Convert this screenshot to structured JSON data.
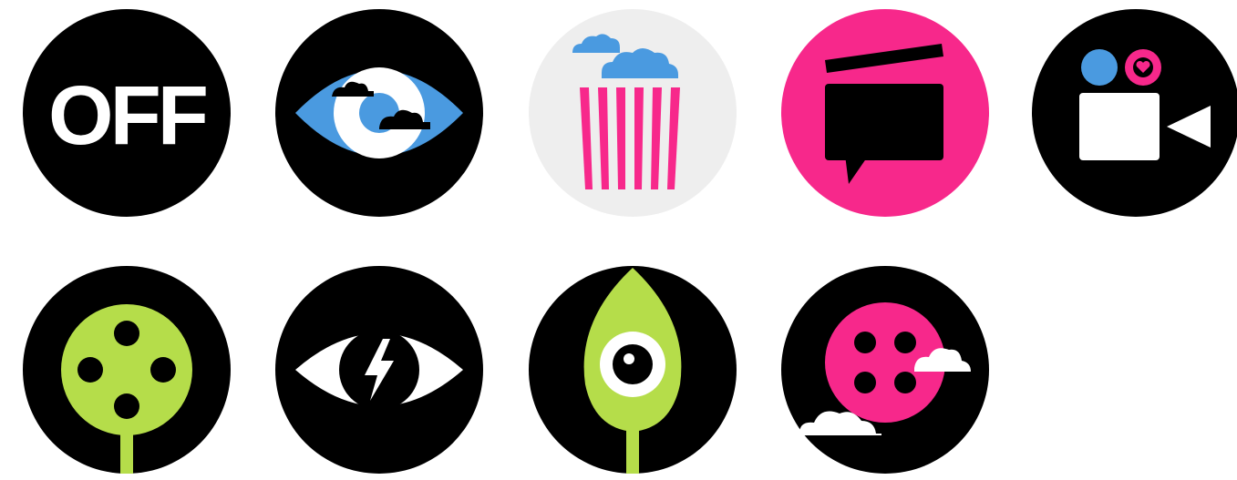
{
  "icons": [
    {
      "name": "off-badge",
      "label": "OFF",
      "text_color": "#ffffff",
      "background": "#000000"
    },
    {
      "name": "eye-clouds-badge",
      "background": "#000000",
      "accent": "#4a9ae0"
    },
    {
      "name": "popcorn-badge",
      "background": "#eeeeee",
      "accent": "#f7288b",
      "secondary": "#4a9ae0"
    },
    {
      "name": "clapperboard-speech-badge",
      "background": "#f7288b",
      "accent": "#000000"
    },
    {
      "name": "video-camera-heart-badge",
      "background": "#000000",
      "accent": "#4a9ae0",
      "secondary": "#f7288b"
    },
    {
      "name": "film-reel-tree-badge",
      "background": "#000000",
      "accent": "#b5dd4a"
    },
    {
      "name": "eye-lightning-badge",
      "background": "#000000",
      "accent": "#ffffff"
    },
    {
      "name": "leaf-eye-badge",
      "background": "#000000",
      "accent": "#b5dd4a"
    },
    {
      "name": "film-reel-clouds-badge",
      "background": "#000000",
      "accent": "#f7288b"
    }
  ]
}
